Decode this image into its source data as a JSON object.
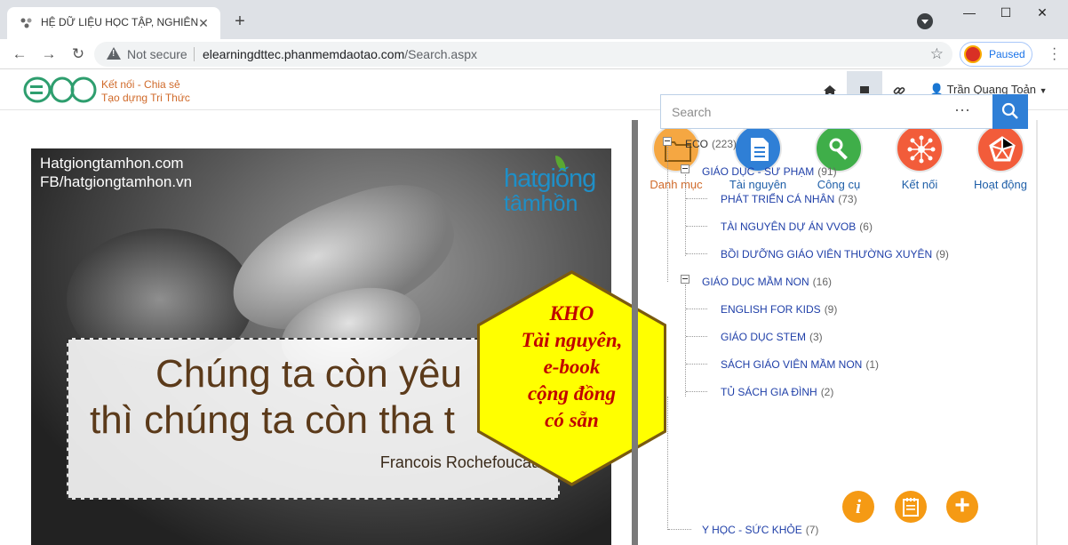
{
  "browser": {
    "tab_title": "HỆ DỮ LIỆU HỌC TẬP, NGHIÊN C",
    "security_label": "Not secure",
    "url_host": "elearningdttec.phanmemdaotao.com",
    "url_path": "/Search.aspx",
    "profile_status": "Paused"
  },
  "site": {
    "logo_text": "ECO",
    "slogan_line1": "Kết nối - Chia sẻ",
    "slogan_line2": "Tạo dựng Tri Thức",
    "user_name": "Trần Quang Toản"
  },
  "banner": {
    "site_line1": "Hatgiongtamhon.com",
    "site_line2": "FB/hatgiongtamhon.vn",
    "logo_line1": "hatgiống",
    "logo_line2": "tâmhồn",
    "quote_line1": "Chúng ta còn yêu",
    "quote_line2": "thì chúng ta còn tha t",
    "quote_author": "Francois Rochefoucauld",
    "hex_lines": [
      "KHO",
      "Tài nguyên,",
      "e-book",
      "cộng đồng",
      "có sẵn"
    ]
  },
  "quick_menu": [
    {
      "label": "Danh mục",
      "color": "#f5a742",
      "active": true,
      "icon": "folder-icon"
    },
    {
      "label": "Tài nguyên",
      "color": "#2f7fd6",
      "active": false,
      "icon": "document-icon"
    },
    {
      "label": "Công cụ",
      "color": "#3fae49",
      "active": false,
      "icon": "tools-icon"
    },
    {
      "label": "Kết nối",
      "color": "#f25c3a",
      "active": false,
      "icon": "network-icon"
    },
    {
      "label": "Hoạt động",
      "color": "#f25c3a",
      "active": false,
      "icon": "activity-icon"
    }
  ],
  "search": {
    "placeholder": "Search",
    "more": "···"
  },
  "tree": [
    {
      "label": "ECO",
      "count": "(223)",
      "level": 0
    },
    {
      "label": "GIÁO DỤC - SƯ PHẠM",
      "count": "(91)",
      "level": 1
    },
    {
      "label": "PHÁT TRIỂN CÁ NHÂN",
      "count": "(73)",
      "level": 2
    },
    {
      "label": "TÀI NGUYÊN DỰ ÁN VVOB",
      "count": "(6)",
      "level": 2
    },
    {
      "label": "BỒI DƯỠNG GIÁO VIÊN THƯỜNG XUYÊN",
      "count": "(9)",
      "level": 2
    },
    {
      "label": "GIÁO DỤC MẦM NON",
      "count": "(16)",
      "level": 1
    },
    {
      "label": "ENGLISH FOR KIDS",
      "count": "(9)",
      "level": 2
    },
    {
      "label": "GIÁO DỤC STEM",
      "count": "(3)",
      "level": 2
    },
    {
      "label": "SÁCH GIÁO VIÊN MẦM NON",
      "count": "(1)",
      "level": 2
    },
    {
      "label": "TỦ SÁCH GIA ĐÌNH",
      "count": "(2)",
      "level": 2
    },
    {
      "label": "Y HỌC - SỨC KHỎE",
      "count": "(7)",
      "level": 1
    }
  ],
  "fabs": {
    "info": "i",
    "add": "+"
  }
}
